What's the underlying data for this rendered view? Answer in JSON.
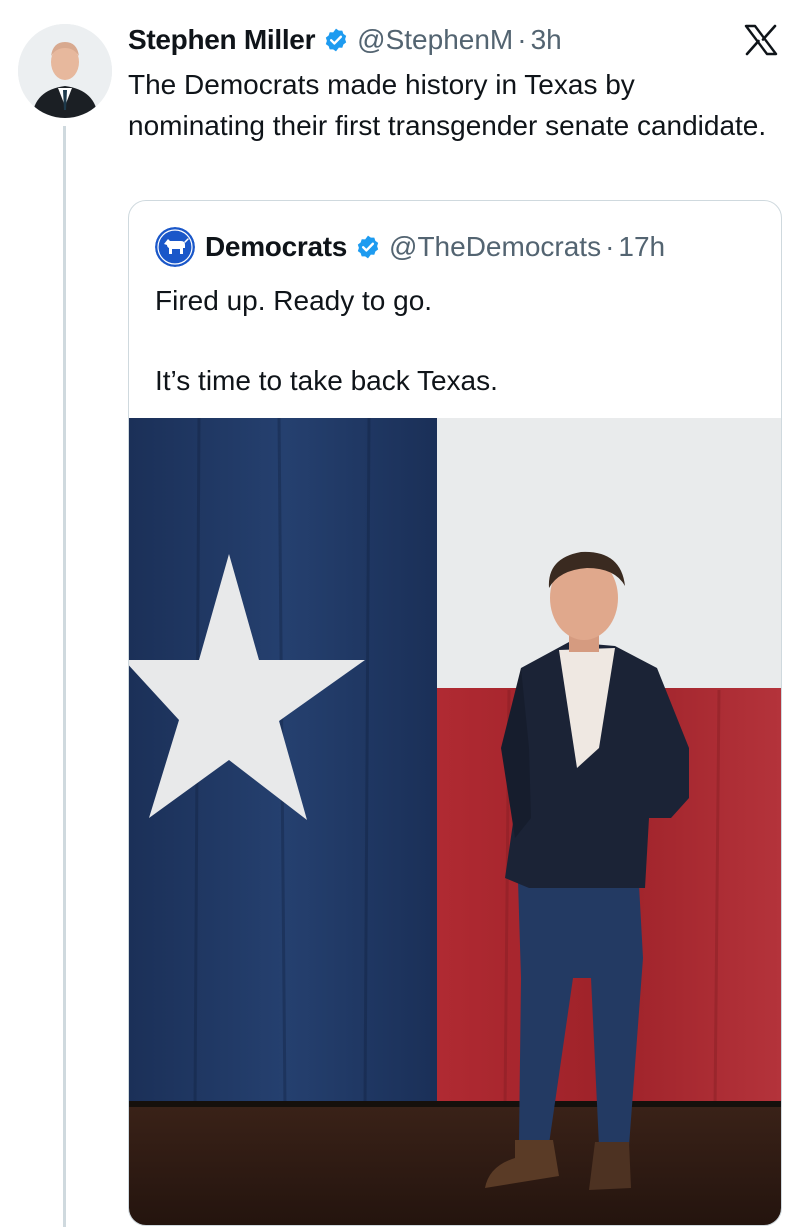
{
  "tweet": {
    "author_name": "Stephen Miller",
    "handle": "@StephenM",
    "separator": "·",
    "time": "3h",
    "text": "The Democrats made history in Texas by nominating their first transgender senate candidate.",
    "avatar_icon": "person-portrait",
    "verified_icon": "verified-badge-icon",
    "platform_icon": "x-logo-icon"
  },
  "quote": {
    "author_name": "Democrats",
    "handle": "@TheDemocrats",
    "separator": "·",
    "time": "17h",
    "avatar_icon": "democratic-donkey-logo",
    "line1": "Fired up. Ready to go.",
    "line2": "It’s time to take back Texas.",
    "media": "photo-man-standing-before-texas-flag"
  },
  "colors": {
    "verified_blue": "#1d9bf0",
    "muted_text": "#536471",
    "border": "#cfd9de",
    "flag_blue": "#1f3763",
    "flag_red": "#a8242c",
    "flag_white": "#e9ebec"
  }
}
